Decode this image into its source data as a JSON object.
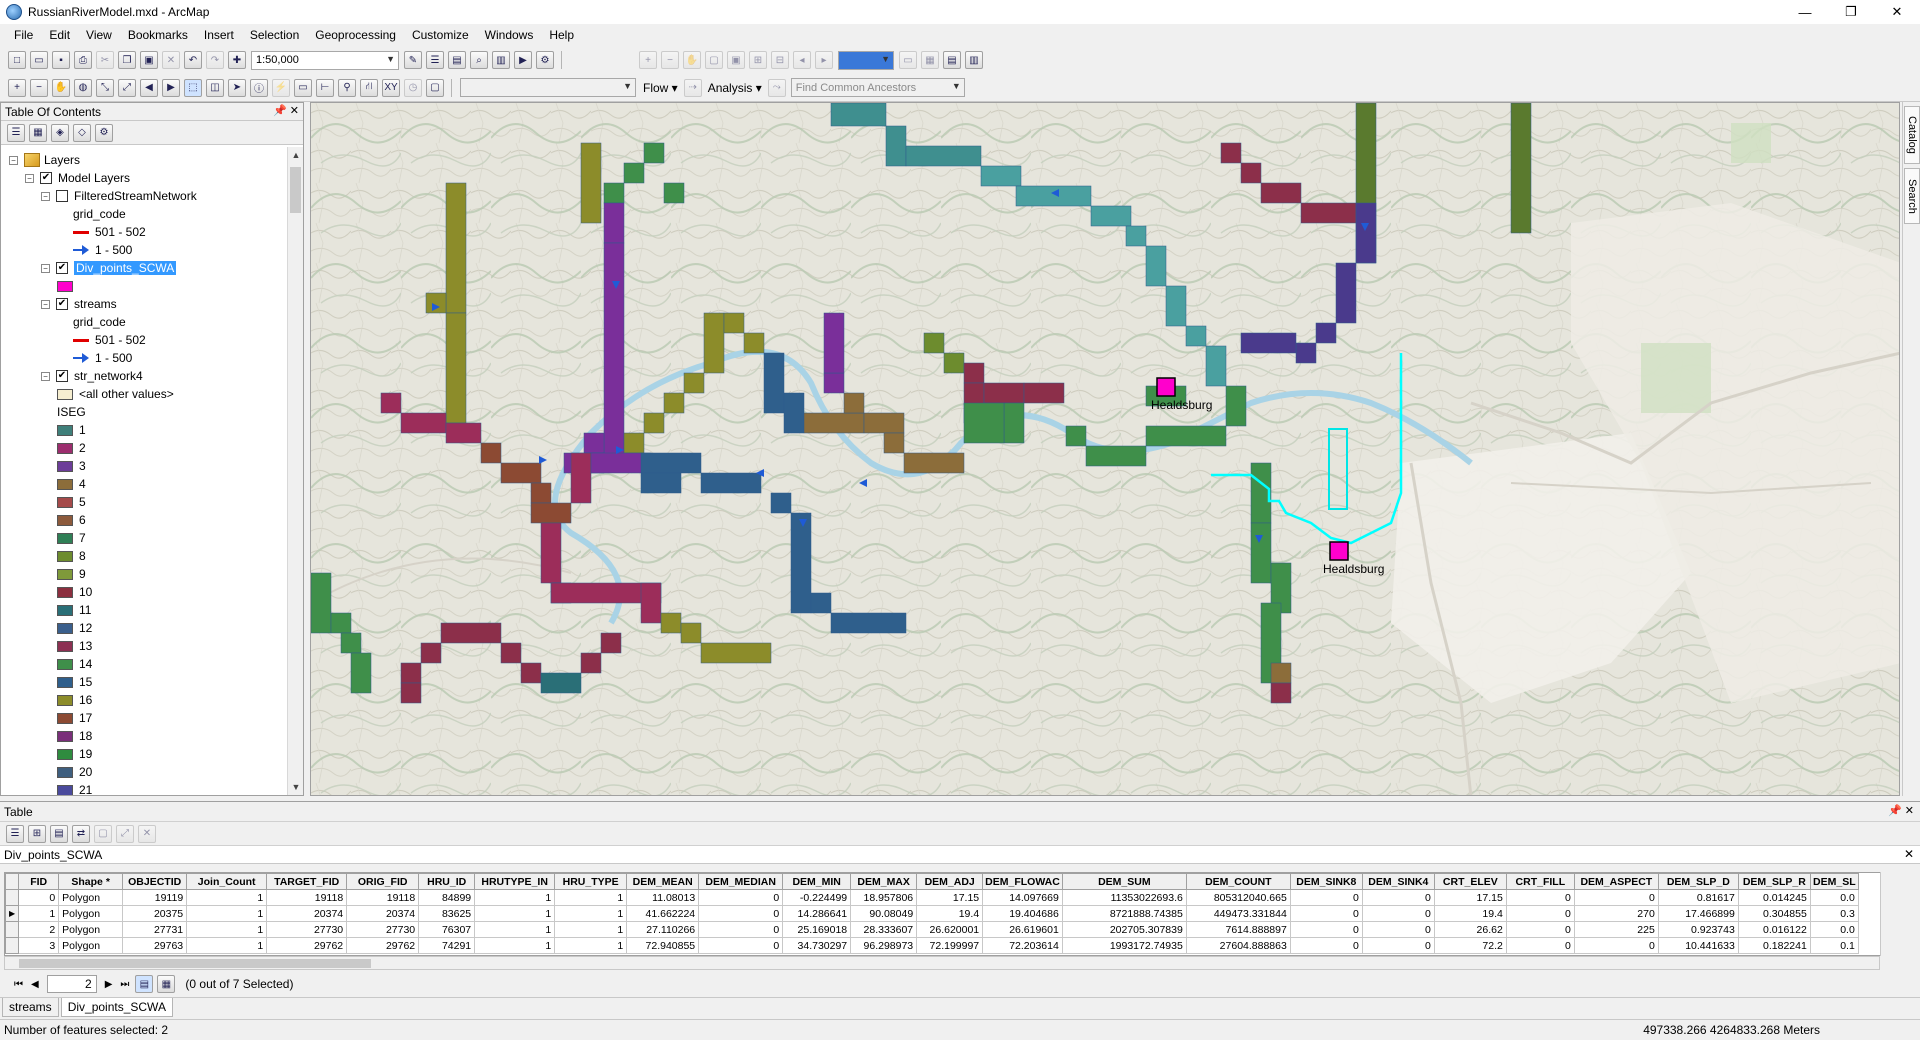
{
  "window": {
    "title": "RussianRiverModel.mxd - ArcMap",
    "minimize": "—",
    "maximize": "❐",
    "close": "✕"
  },
  "menus": [
    "File",
    "Edit",
    "View",
    "Bookmarks",
    "Insert",
    "Selection",
    "Geoprocessing",
    "Customize",
    "Windows",
    "Help"
  ],
  "toolbar": {
    "scale_value": "1:50,000",
    "flow_label": "Flow ▾",
    "analysis_label": "Analysis ▾",
    "find_ancestors": "Find Common Ancestors"
  },
  "toc": {
    "title": "Table Of Contents",
    "rows": [
      {
        "indent": 0,
        "expander": "⊟",
        "kind": "group",
        "label": "Layers"
      },
      {
        "indent": 1,
        "expander": "⊟",
        "kind": "check",
        "checked": true,
        "label": "Model Layers"
      },
      {
        "indent": 2,
        "expander": "⊟",
        "kind": "check",
        "checked": false,
        "label": "FilteredStreamNetwork"
      },
      {
        "indent": 4,
        "kind": "text",
        "label": "grid_code"
      },
      {
        "indent": 4,
        "kind": "line",
        "label": "501 - 502"
      },
      {
        "indent": 4,
        "kind": "arrow",
        "label": "1 - 500"
      },
      {
        "indent": 2,
        "expander": "⊟",
        "kind": "check",
        "checked": true,
        "label": "Div_points_SCWA",
        "selected": true
      },
      {
        "indent": 3,
        "kind": "swatch",
        "color": "#ff00cc",
        "label": ""
      },
      {
        "indent": 2,
        "expander": "⊟",
        "kind": "check",
        "checked": true,
        "label": "streams"
      },
      {
        "indent": 4,
        "kind": "text",
        "label": "grid_code"
      },
      {
        "indent": 4,
        "kind": "line",
        "label": "501 - 502"
      },
      {
        "indent": 4,
        "kind": "arrow",
        "label": "1 - 500"
      },
      {
        "indent": 2,
        "expander": "⊟",
        "kind": "check",
        "checked": true,
        "label": "str_network4"
      },
      {
        "indent": 3,
        "kind": "swatch",
        "color": "#f6eed0",
        "label": "<all other values>"
      },
      {
        "indent": 3,
        "kind": "text",
        "label": "ISEG"
      },
      {
        "indent": 3,
        "kind": "swatch",
        "color": "#3f7f7a",
        "label": "1"
      },
      {
        "indent": 3,
        "kind": "swatch",
        "color": "#9c2d6e",
        "label": "2"
      },
      {
        "indent": 3,
        "kind": "swatch",
        "color": "#6c3d99",
        "label": "3"
      },
      {
        "indent": 3,
        "kind": "swatch",
        "color": "#8c6d3a",
        "label": "4"
      },
      {
        "indent": 3,
        "kind": "swatch",
        "color": "#a54a4a",
        "label": "5"
      },
      {
        "indent": 3,
        "kind": "swatch",
        "color": "#8c5a3c",
        "label": "6"
      },
      {
        "indent": 3,
        "kind": "swatch",
        "color": "#2f7f56",
        "label": "7"
      },
      {
        "indent": 3,
        "kind": "swatch",
        "color": "#6d8c2e",
        "label": "8"
      },
      {
        "indent": 3,
        "kind": "swatch",
        "color": "#7f9a3a",
        "label": "9"
      },
      {
        "indent": 3,
        "kind": "swatch",
        "color": "#8c2f3f",
        "label": "10"
      },
      {
        "indent": 3,
        "kind": "swatch",
        "color": "#2a6f77",
        "label": "11"
      },
      {
        "indent": 3,
        "kind": "swatch",
        "color": "#3a5f8c",
        "label": "12"
      },
      {
        "indent": 3,
        "kind": "swatch",
        "color": "#8c3052",
        "label": "13"
      },
      {
        "indent": 3,
        "kind": "swatch",
        "color": "#3f8f4a",
        "label": "14"
      },
      {
        "indent": 3,
        "kind": "swatch",
        "color": "#2f5f8c",
        "label": "15"
      },
      {
        "indent": 3,
        "kind": "swatch",
        "color": "#8c8c2a",
        "label": "16"
      },
      {
        "indent": 3,
        "kind": "swatch",
        "color": "#8c4a33",
        "label": "17"
      },
      {
        "indent": 3,
        "kind": "swatch",
        "color": "#7a2f7a",
        "label": "18"
      },
      {
        "indent": 3,
        "kind": "swatch",
        "color": "#2f8c3f",
        "label": "19"
      },
      {
        "indent": 3,
        "kind": "swatch",
        "color": "#3f5f7f",
        "label": "20"
      },
      {
        "indent": 3,
        "kind": "swatch",
        "color": "#4a4a9c",
        "label": "21"
      }
    ]
  },
  "map": {
    "labels": {
      "healdsburg_1": "Healdsburg",
      "healdsburg_2": "Healdsburg"
    },
    "dock_tabs": {
      "catalog": "Catalog",
      "search": "Search"
    }
  },
  "table_window": {
    "title": "Table",
    "layer_name": "Div_points_SCWA",
    "columns": [
      "FID",
      "Shape *",
      "OBJECTID",
      "Join_Count",
      "TARGET_FID",
      "ORIG_FID",
      "HRU_ID",
      "HRUTYPE_IN",
      "HRU_TYPE",
      "DEM_MEAN",
      "DEM_MEDIAN",
      "DEM_MIN",
      "DEM_MAX",
      "DEM_ADJ",
      "DEM_FLOWAC",
      "DEM_SUM",
      "DEM_COUNT",
      "DEM_SINK8",
      "DEM_SINK4",
      "CRT_ELEV",
      "CRT_FILL",
      "DEM_ASPECT",
      "DEM_SLP_D",
      "DEM_SLP_R",
      "DEM_SL"
    ],
    "rows": [
      [
        "0",
        "Polygon",
        "19119",
        "1",
        "19118",
        "19118",
        "84899",
        "1",
        "1",
        "11.08013",
        "0",
        "-0.224499",
        "18.957806",
        "17.15",
        "14.097669",
        "11353022693.6",
        "805312040.665",
        "0",
        "0",
        "17.15",
        "0",
        "0",
        "0.81617",
        "0.014245",
        "0.0"
      ],
      [
        "1",
        "Polygon",
        "20375",
        "1",
        "20374",
        "20374",
        "83625",
        "1",
        "1",
        "41.662224",
        "0",
        "14.286641",
        "90.08049",
        "19.4",
        "19.404686",
        "8721888.74385",
        "449473.331844",
        "0",
        "0",
        "19.4",
        "0",
        "270",
        "17.466899",
        "0.304855",
        "0.3"
      ],
      [
        "2",
        "Polygon",
        "27731",
        "1",
        "27730",
        "27730",
        "76307",
        "1",
        "1",
        "27.110266",
        "0",
        "25.169018",
        "28.333607",
        "26.620001",
        "26.619601",
        "202705.307839",
        "7614.888897",
        "0",
        "0",
        "26.62",
        "0",
        "225",
        "0.923743",
        "0.016122",
        "0.0"
      ],
      [
        "3",
        "Polygon",
        "29763",
        "1",
        "29762",
        "29762",
        "74291",
        "1",
        "1",
        "72.940855",
        "0",
        "34.730297",
        "96.298973",
        "72.199997",
        "72.203614",
        "1993172.74935",
        "27604.888863",
        "0",
        "0",
        "72.2",
        "0",
        "0",
        "10.441633",
        "0.182241",
        "0.1"
      ]
    ],
    "nav_record": "2",
    "selection_text": "(0 out of 7 Selected)"
  },
  "bottom_tabs": [
    "streams",
    "Div_points_SCWA"
  ],
  "status": {
    "left": "Number of features selected: 2",
    "coords": "497338.266  4264833.268 Meters"
  }
}
